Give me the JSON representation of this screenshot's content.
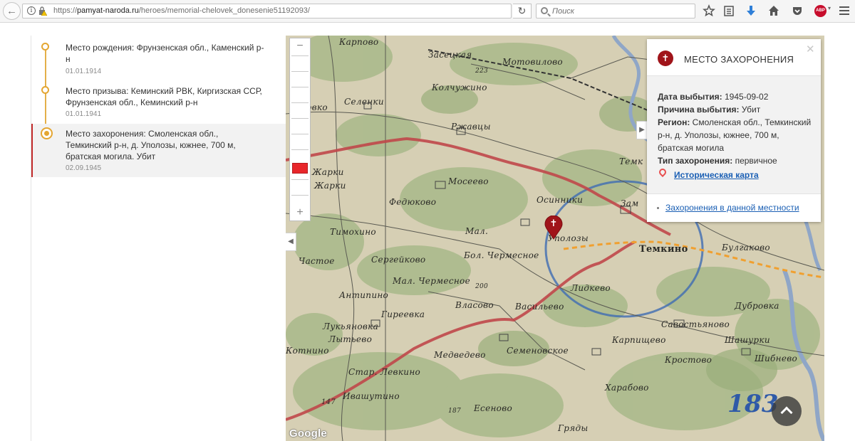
{
  "browser": {
    "url_prefix": "https://",
    "url_host": "pamyat-naroda.ru",
    "url_path": "/heroes/memorial-chelovek_donesenie51192093/",
    "search_placeholder": "Поиск",
    "info_glyph": "i",
    "reload_glyph": "↻",
    "back_glyph": "←",
    "abp_label": "ABP",
    "icons": [
      "bookmark-star-icon",
      "reading-list-icon",
      "download-icon",
      "home-icon",
      "pocket-icon",
      "adblock-icon",
      "menu-icon"
    ]
  },
  "timeline": {
    "items": [
      {
        "text": "Место рождения: Фрунзенская обл., Каменский р-н",
        "date": "01.01.1914"
      },
      {
        "text": "Место призыва: Кеминский РВК, Киргизская ССР, Фрунзенская обл., Кеминский р-н",
        "date": "01.01.1941"
      },
      {
        "text": "Место захоронения: Смоленская обл., Темкинский р-н, д. Уполозы, южнее, 700 м, братская могила. Убит",
        "date": "02.09.1945"
      }
    ],
    "accent_color": "#e4a632",
    "active_color": "#c22a2a"
  },
  "map": {
    "zoom_in": "+",
    "zoom_out": "−",
    "collapse_glyph": "◀",
    "expand_glyph": "▶",
    "attribution": "Google",
    "places": [
      "Карпово",
      "Засецкая",
      "Мотовилово",
      "Колчужино",
      "Селенки",
      "Ржавцы",
      "Федюково",
      "Мосеево",
      "Осинники",
      "Тимохино",
      "Мал.",
      "Уполозы",
      "Бол. Чермесное",
      "Сергейково",
      "Частое",
      "Антипино",
      "Мал. Чермесное",
      "Власово",
      "Гиреевка",
      "Лукьяновка",
      "Лытьево",
      "Котнино",
      "Медведево",
      "Семеновское",
      "Васильево",
      "Лидкево",
      "Темкино",
      "Булгаково",
      "Дубровка",
      "Савостьяново",
      "Карпищево",
      "Шашурки",
      "Кростово",
      "Шибнево",
      "Стар. Левкино",
      "Ивашутино",
      "Есеново",
      "Гряды",
      "Харабово",
      "Бровко",
      "Жарки",
      "Жарки",
      "Зам",
      "Темк"
    ],
    "numbers": [
      "223",
      "200",
      "147",
      "187",
      "183"
    ],
    "marker_glyph": "✝",
    "marker_color": "#a0141a"
  },
  "card": {
    "title": "МЕСТО ЗАХОРОНЕНИЯ",
    "close_glyph": "✕",
    "icon_glyph": "✝",
    "rows": [
      {
        "label": "Дата выбытия:",
        "value": "1945-09-02"
      },
      {
        "label": "Причина выбытия:",
        "value": "Убит"
      },
      {
        "label": "Регион:",
        "value": "Смоленская обл., Темкинский р-н, д. Уполозы, южнее, 700 м, братская могила"
      },
      {
        "label": "Тип захоронения:",
        "value": "первичное"
      }
    ],
    "map_link": "Историческая карта",
    "foot_link": "Захоронения в данной местности",
    "link_color": "#1a5fb4"
  }
}
